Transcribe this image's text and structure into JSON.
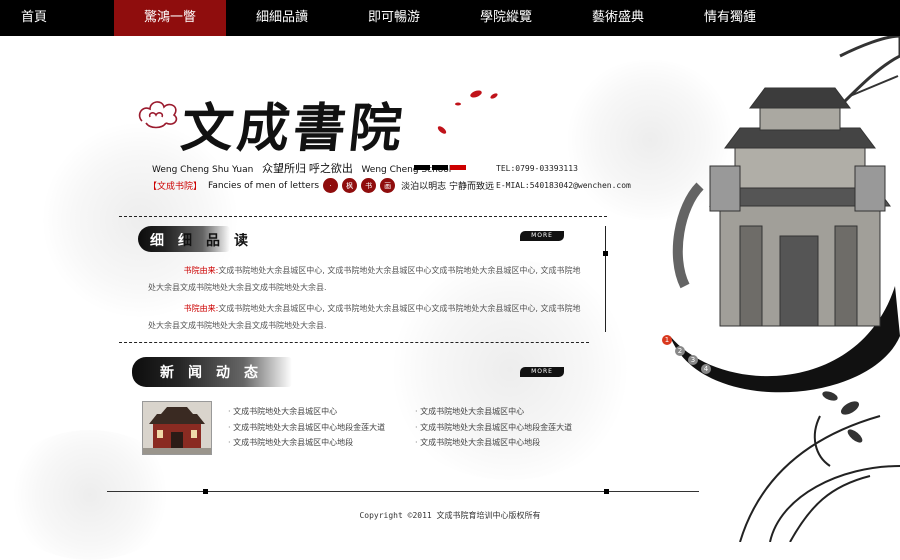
{
  "nav": {
    "items": [
      "首頁",
      "驚鴻一瞥",
      "細細品讀",
      "即可暢游",
      "學院縱覽",
      "藝術盛典",
      "情有獨鍾"
    ],
    "active_index": 1
  },
  "logo": {
    "title": "文成書院",
    "line1_left": "Weng Cheng  Shu Yuan",
    "line1_middle_a": "众望所归",
    "line1_middle_b": "呼之欲出",
    "line1_right": "Weng Cheng  School",
    "tag": "【文成书院】",
    "slogan_en": "Fancies of men of letters",
    "seals": [
      "·",
      "枫",
      "书",
      "画"
    ],
    "motto": "淡泊以明志  宁静而致远"
  },
  "contact": {
    "tel": "TEL:0799-03393113",
    "email": "E-MIAL:540183042@wenchen.com"
  },
  "read_section": {
    "title": "细细品读",
    "more": "MORE",
    "paragraphs": [
      {
        "label": "书院由来:",
        "text": "文成书院地处大余县城区中心, 文成书院地处大余县城区中心文成书院地处大余县城区中心, 文成书院地处大余县文成书院地处大余县文成书院地处大余县."
      },
      {
        "label": "书院由来:",
        "text": "文成书院地处大余县城区中心, 文成书院地处大余县城区中心文成书院地处大余县城区中心, 文成书院地处大余县文成书院地处大余县文成书院地处大余县."
      }
    ]
  },
  "news_section": {
    "title": "新闻动态",
    "more": "MORE",
    "col1": [
      "文成书院地处大余县城区中心",
      "文成书院地处大余县城区中心地段金莲大道",
      "文成书院地处大余县城区中心地段"
    ],
    "col2": [
      "文成书院地处大余县城区中心",
      "文成书院地处大余县城区中心地段金莲大道",
      "文成书院地处大余县城区中心地段"
    ]
  },
  "pager": [
    "1",
    "2",
    "3",
    "4"
  ],
  "footer": {
    "copyright": "Copyright ©2011 文成书院育培训中心版权所有"
  },
  "colors": {
    "nav_bg": "#000000",
    "nav_active": "#8f0d0d",
    "accent_red": "#cc0000"
  }
}
